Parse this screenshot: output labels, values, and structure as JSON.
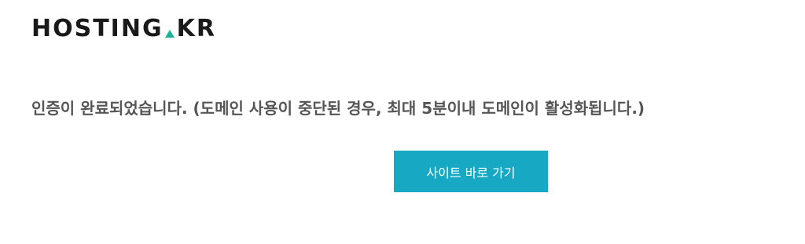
{
  "logo": {
    "part1": "HOSTING",
    "part2": "KR",
    "accent_color": "#1ab394"
  },
  "message": "인증이 완료되었습니다. (도메인 사용이 중단된 경우, 최대 5분이내 도메인이 활성화됩니다.)",
  "button": {
    "label": "사이트 바로 가기",
    "color": "#17a8c4"
  }
}
